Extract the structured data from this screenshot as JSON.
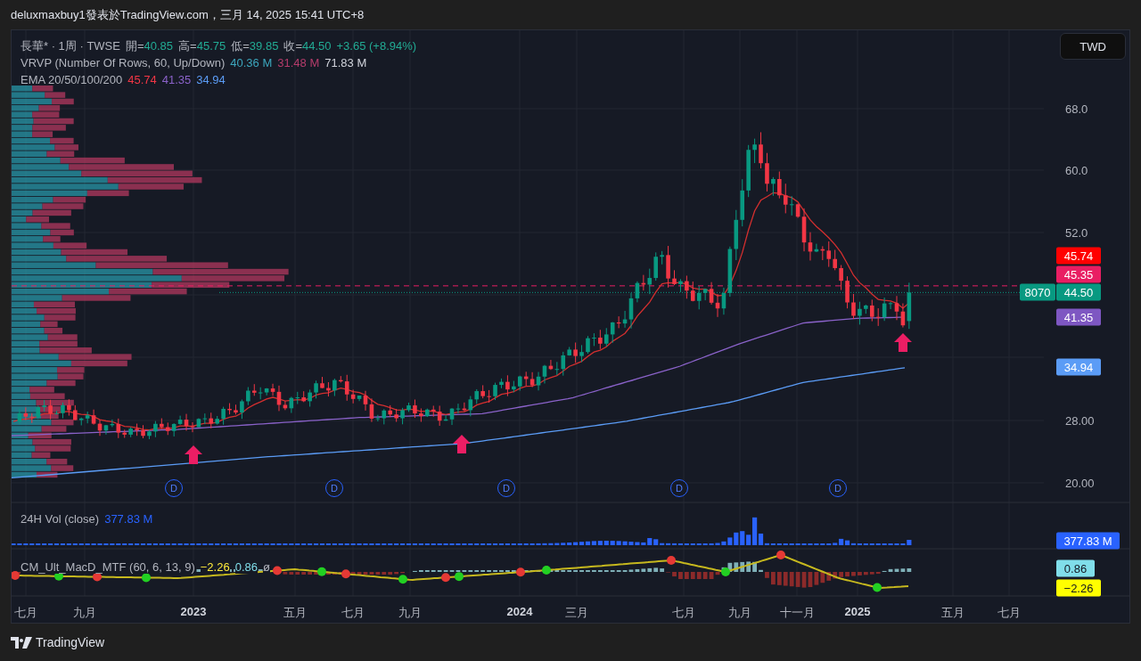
{
  "header": {
    "text": "deluxmaxbuy1發表於TradingView.com，三月 14, 2025 15:41 UTC+8"
  },
  "legend": {
    "symbol": "長華* · 1周 · TWSE",
    "ohlc": [
      {
        "label": "開=",
        "value": "40.85"
      },
      {
        "label": "高=",
        "value": "45.75"
      },
      {
        "label": "低=",
        "value": "39.85"
      },
      {
        "label": "收=",
        "value": "44.50"
      }
    ],
    "change": "+3.65 (+8.94%)"
  },
  "vrvp": {
    "name": "VRVP (Number Of Rows, 60, Up/Down)",
    "values": [
      {
        "text": "40.36 M",
        "color": "#3ca6bd"
      },
      {
        "text": "31.48 M",
        "color": "#b53c6b"
      },
      {
        "text": "71.83 M",
        "color": "#d1d4dc"
      }
    ]
  },
  "ema": {
    "name": "EMA 20/50/100/200",
    "values": [
      {
        "text": "45.74",
        "color": "#f23645"
      },
      {
        "text": "41.35",
        "color": "#8a62c9"
      },
      {
        "text": "34.94",
        "color": "#5b9cf6"
      }
    ]
  },
  "currency_button": "TWD",
  "price_scale": {
    "ticks": [
      "68.0",
      "60.0",
      "52.0",
      "28.00",
      "20.00"
    ],
    "countdown": "8070",
    "labels": [
      {
        "text": "45.74",
        "color": "#ff0000"
      },
      {
        "text": "45.35",
        "color": "#e91e63"
      },
      {
        "text": "44.50",
        "color": "#089981"
      },
      {
        "text": "41.35",
        "color": "#7e57c2"
      },
      {
        "text": "34.94",
        "color": "#5b9cf6"
      }
    ]
  },
  "dividend_markers": [
    "D",
    "D",
    "D",
    "D",
    "D"
  ],
  "volume": {
    "name": "24H Vol (close)",
    "value": "377.83 M",
    "scale_label": "377.83 M"
  },
  "macd": {
    "name": "CM_Ult_MacD_MTF (60, 6, 13, 9)",
    "values": [
      {
        "text": "−2.26",
        "color": "#ffeb3b"
      },
      {
        "text": "0.86",
        "color": "#80deea"
      },
      {
        "text": "ø",
        "color": "#b2b5be"
      }
    ],
    "scale_labels": [
      {
        "text": "0.86",
        "color": "#80deea"
      },
      {
        "text": "−2.26",
        "color": "#ffff00"
      }
    ]
  },
  "time_axis": [
    {
      "label": "七月",
      "kind": "month"
    },
    {
      "label": "九月",
      "kind": "month"
    },
    {
      "label": "2023",
      "kind": "year"
    },
    {
      "label": "五月",
      "kind": "month"
    },
    {
      "label": "七月",
      "kind": "month"
    },
    {
      "label": "九月",
      "kind": "month"
    },
    {
      "label": "2024",
      "kind": "year"
    },
    {
      "label": "三月",
      "kind": "month"
    },
    {
      "label": "七月",
      "kind": "month"
    },
    {
      "label": "九月",
      "kind": "month"
    },
    {
      "label": "十一月",
      "kind": "month"
    },
    {
      "label": "2025",
      "kind": "year"
    },
    {
      "label": "五月",
      "kind": "month"
    },
    {
      "label": "七月",
      "kind": "month"
    }
  ],
  "footer": {
    "brand": "TradingView"
  }
}
